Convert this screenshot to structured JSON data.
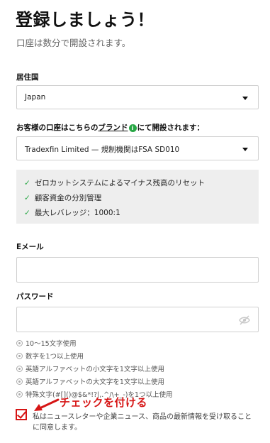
{
  "header": {
    "title": "登録しましょう！",
    "subtitle": "口座は数分で開設されます。"
  },
  "residence": {
    "label": "居住国",
    "value": "Japan"
  },
  "brand": {
    "label_prefix": "お客様の口座はこちらの",
    "label_link": "ブランド",
    "label_suffix": "にて開設されます：",
    "value": "Tradexfin Limited — 規制機関はFSA SD010"
  },
  "features": [
    "ゼロカットシステムによるマイナス残高のリセット",
    "顧客資金の分別管理",
    "最大レバレッジ：1000:1"
  ],
  "email": {
    "label": "Eメール",
    "value": ""
  },
  "password": {
    "label": "パスワード",
    "value": "",
    "rules": [
      "10～15文字使用",
      "数字を1つ以上使用",
      "英語アルファベットの小文字を1文字以上使用",
      "英語アルファベットの大文字を1文字以上使用",
      "特殊文字(#[]()@$&*!?|,.^/\\+_-)を1つ以上使用"
    ]
  },
  "annotation": {
    "text": "チェックを付ける"
  },
  "consent": {
    "checked": true,
    "text": "私はニュースレターや企業ニュース、商品の最新情報を受け取ることに同意します。"
  },
  "colors": {
    "accent_green": "#28a745",
    "annotation_red": "#d61515",
    "feature_bg": "#eeeeee"
  }
}
